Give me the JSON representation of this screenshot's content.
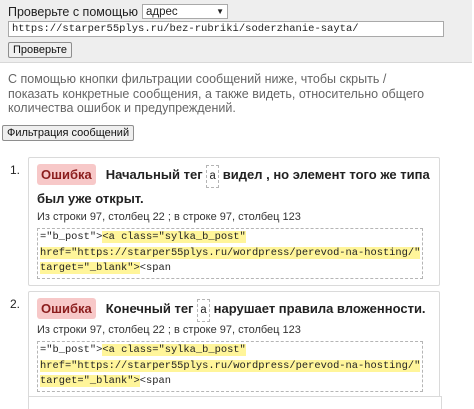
{
  "check_panel": {
    "label": "Проверьте с помощью",
    "mode": "адрес",
    "url": "https://starper55plys.ru/bez-rubriki/soderzhanie-sayta/",
    "check_button": "Проверьте"
  },
  "description": "С помощью кнопки фильтрации сообщений ниже, чтобы скрыть / показать конкретные сообщения, а также видеть, относительно общего количества ошибок и предупреждений.",
  "filter_button": "Фильтрация сообщений",
  "messages": [
    {
      "num": "1.",
      "badge": "Ошибка",
      "text_before": "Начальный тег",
      "tag": "a",
      "text_after": "видел , но элемент того же типа был уже открыт.",
      "from_label": "Из строки",
      "from_line": "97",
      "from_col_label": "столбец",
      "from_col": "22",
      "to_label": "в строке",
      "to_line": "97",
      "to_col_label": "столбец",
      "to_col": "123",
      "code_l1_pre": "=\"b_post\">",
      "code_l1_hl": "<a class=\"sylka_b_post\"",
      "code_l2_hl": "href=\"https://starper55plys.ru/wordpress/perevod-na-hosting/\"",
      "code_l3_hl": "target=\"_blank\">",
      "code_l3_post": "<span"
    },
    {
      "num": "2.",
      "badge": "Ошибка",
      "text_before": "Конечный тег",
      "tag": "a",
      "text_after": "нарушает правила вложенности.",
      "from_label": "Из строки",
      "from_line": "97",
      "from_col_label": "столбец",
      "from_col": "22",
      "to_label": "в строке",
      "to_line": "97",
      "to_col_label": "столбец",
      "to_col": "123",
      "code_l1_pre": "=\"b_post\">",
      "code_l1_hl": "<a class=\"sylka_b_post\"",
      "code_l2_hl": "href=\"https://starper55plys.ru/wordpress/perevod-na-hosting/\"",
      "code_l3_hl": "target=\"_blank\">",
      "code_l3_post": "<span"
    }
  ]
}
